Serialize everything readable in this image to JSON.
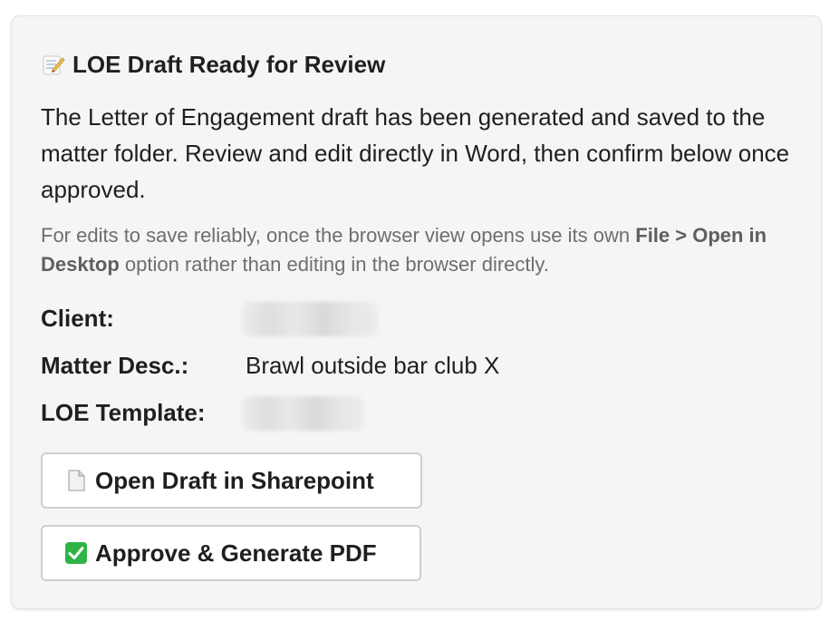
{
  "card": {
    "title": "LOE Draft Ready for Review",
    "title_icon": "memo-icon",
    "intro": "The Letter of Engagement draft has been generated and saved to the matter folder. Review and edit directly in Word, then confirm below once approved.",
    "note": {
      "part1": "For edits to save reliably, once the browser view opens use its own ",
      "bold": "File > Open in Desktop",
      "part2": " option rather than editing in the browser directly."
    },
    "fields": {
      "client_label": "Client:",
      "matter_label": "Matter Desc.:",
      "matter_value": "Brawl outside bar club X",
      "template_label": "LOE Template:"
    },
    "buttons": {
      "open_draft": {
        "label": "Open Draft in Sharepoint",
        "icon": "document-icon"
      },
      "approve": {
        "label": "Approve & Generate PDF",
        "icon": "check-mark-icon",
        "icon_color": "#2fb344"
      }
    }
  }
}
